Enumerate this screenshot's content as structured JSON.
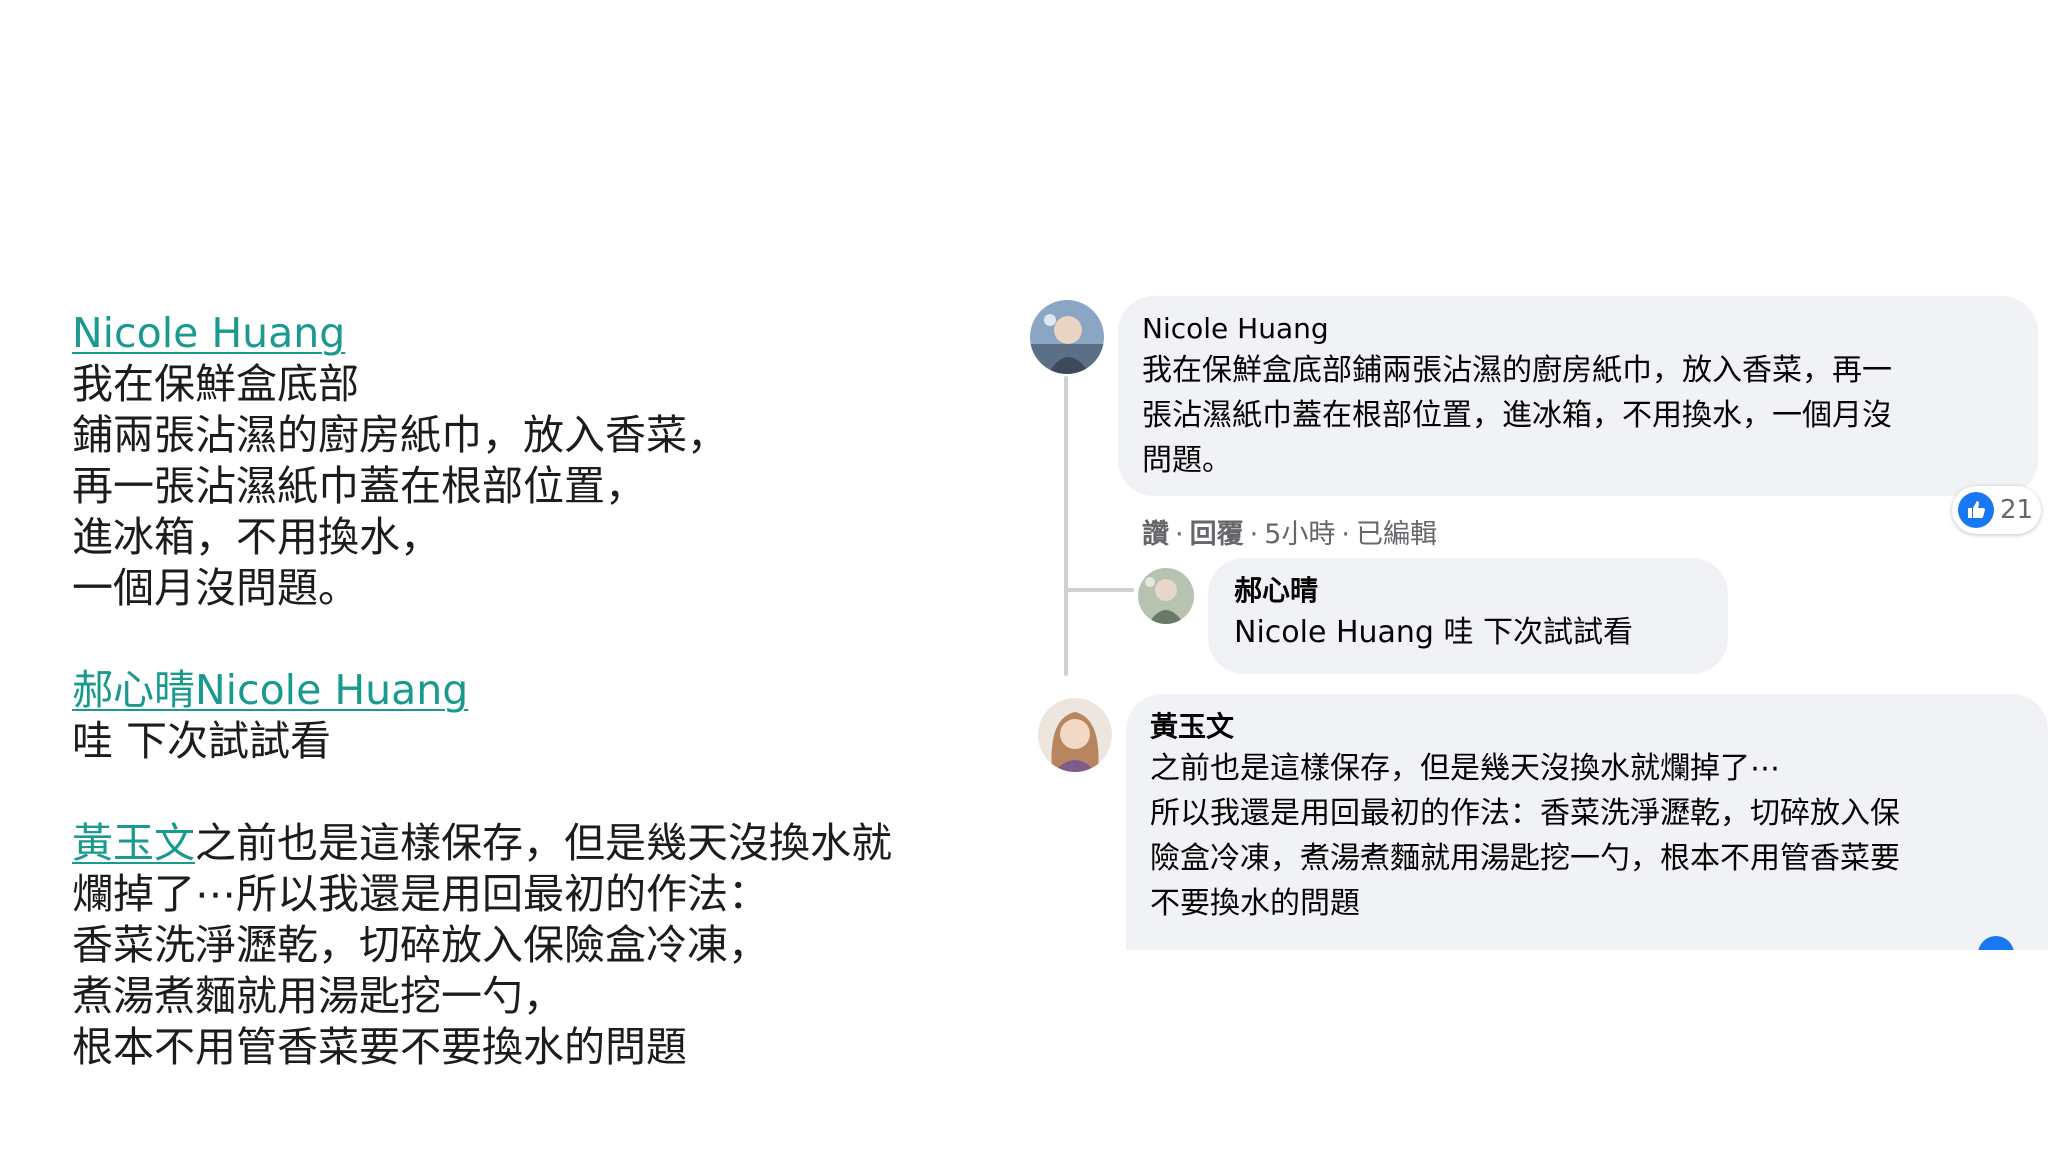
{
  "transcript": {
    "c1_name": "Nicole Huang",
    "c1_lines": [
      "我在保鮮盒底部",
      "鋪兩張沾濕的廚房紙巾，放入香菜，",
      "再一張沾濕紙巾蓋在根部位置，",
      "進冰箱，不用換水，",
      "一個月沒問題。"
    ],
    "c2_name": "郝心晴Nicole Huang",
    "c2_line": "哇 下次試試看",
    "c3_name": "黃玉文",
    "c3_first": "之前也是這樣保存，但是幾天沒換水就",
    "c3_lines": [
      "爛掉了⋯所以我還是用回最初的作法：",
      "香菜洗淨瀝乾，切碎放入保險盒冷凍，",
      "煮湯煮麵就用湯匙挖一勺，",
      "根本不用管香菜要不要換水的問題"
    ]
  },
  "comments": {
    "c1": {
      "name": "Nicole Huang",
      "text_lines": [
        "我在保鮮盒底部鋪兩張沾濕的廚房紙巾，放入香菜，再一",
        "張沾濕紙巾蓋在根部位置，進冰箱，不用換水，一個月沒",
        "問題。"
      ],
      "like_label": "讚",
      "reply_label": "回覆",
      "time": "5小時",
      "edited": "已編輯",
      "reaction_icon": "like-thumb-icon",
      "reaction_count": "21"
    },
    "c2": {
      "name": "郝心晴",
      "mention": "Nicole Huang",
      "text": " 哇 下次試試看"
    },
    "c3": {
      "name": "黃玉文",
      "text_lines": [
        "之前也是這樣保存，但是幾天沒換水就爛掉了⋯",
        "所以我還是用回最初的作法：香菜洗淨瀝乾，切碎放入保",
        "險盒冷凍，煮湯煮麵就用湯匙挖一勺，根本不用管香菜要",
        "不要換水的問題"
      ]
    }
  },
  "colors": {
    "link": "#1a9a8f",
    "bubble": "#f0f2f5",
    "meta": "#65676b",
    "like_blue": "#1877f2"
  }
}
